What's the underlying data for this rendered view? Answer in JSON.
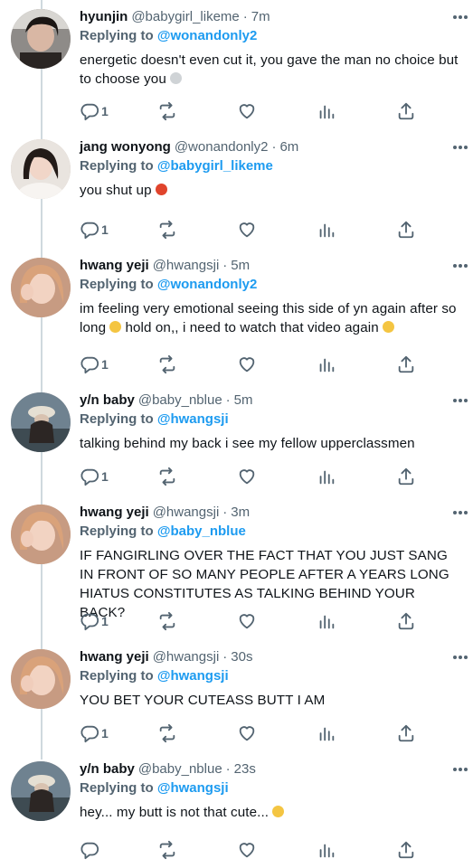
{
  "tweets": [
    {
      "name": "hyunjin",
      "handle": "@babygirl_likeme",
      "time": "7m",
      "reply_prefix": "Replying to",
      "reply_to": "@wonandonly2",
      "text": "energetic doesn't even cut it, you gave the man no choice but to choose you",
      "emoji": "skull-emoji",
      "replies": "1",
      "avatar": "hyunjin-avatar"
    },
    {
      "name": "jang wonyong",
      "handle": "@wonandonly2",
      "time": "6m",
      "reply_prefix": "Replying to",
      "reply_to": "@babygirl_likeme",
      "text": "you shut up",
      "emoji": "angry-face-emoji",
      "replies": "1",
      "avatar": "wonyong-avatar"
    },
    {
      "name": "hwang yeji",
      "handle": "@hwangsji",
      "time": "5m",
      "reply_prefix": "Replying to",
      "reply_to": "@wonandonly2",
      "text": "im feeling very emotional seeing this side of yn again after so long",
      "text_2": "hold on,, i need to watch that video again",
      "emoji": "crying-face-emoji",
      "emoji_2": "pensive-face-emoji",
      "replies": "1",
      "avatar": "yeji-avatar"
    },
    {
      "name": "y/n baby",
      "handle": "@baby_nblue",
      "time": "5m",
      "reply_prefix": "Replying to",
      "reply_to": "@hwangsji",
      "text": "talking behind my back i see my fellow upperclassmen",
      "replies": "1",
      "avatar": "yn-avatar"
    },
    {
      "name": "hwang yeji",
      "handle": "@hwangsji",
      "time": "3m",
      "reply_prefix": "Replying to",
      "reply_to": "@baby_nblue",
      "text": "IF FANGIRLING OVER THE FACT THAT YOU JUST SANG IN FRONT OF SO MANY PEOPLE AFTER A YEARS LONG HIATUS CONSTITUTES AS TALKING BEHIND YOUR BACK?",
      "replies": "1",
      "avatar": "yeji-avatar"
    },
    {
      "name": "hwang yeji",
      "handle": "@hwangsji",
      "time": "30s",
      "reply_prefix": "Replying to",
      "reply_to": "@hwangsji",
      "text": "YOU BET YOUR CUTEASS BUTT I AM",
      "replies": "1",
      "avatar": "yeji-avatar"
    },
    {
      "name": "y/n baby",
      "handle": "@baby_nblue",
      "time": "23s",
      "reply_prefix": "Replying to",
      "reply_to": "@hwangsji",
      "text": "hey... my butt is not that cute...",
      "emoji": "flushed-face-emoji",
      "replies": "",
      "avatar": "yn-avatar"
    }
  ],
  "colors": {
    "link": "#1d9bf0",
    "muted": "#536471",
    "text": "#0f1419",
    "thread_line": "#cfd9de"
  }
}
